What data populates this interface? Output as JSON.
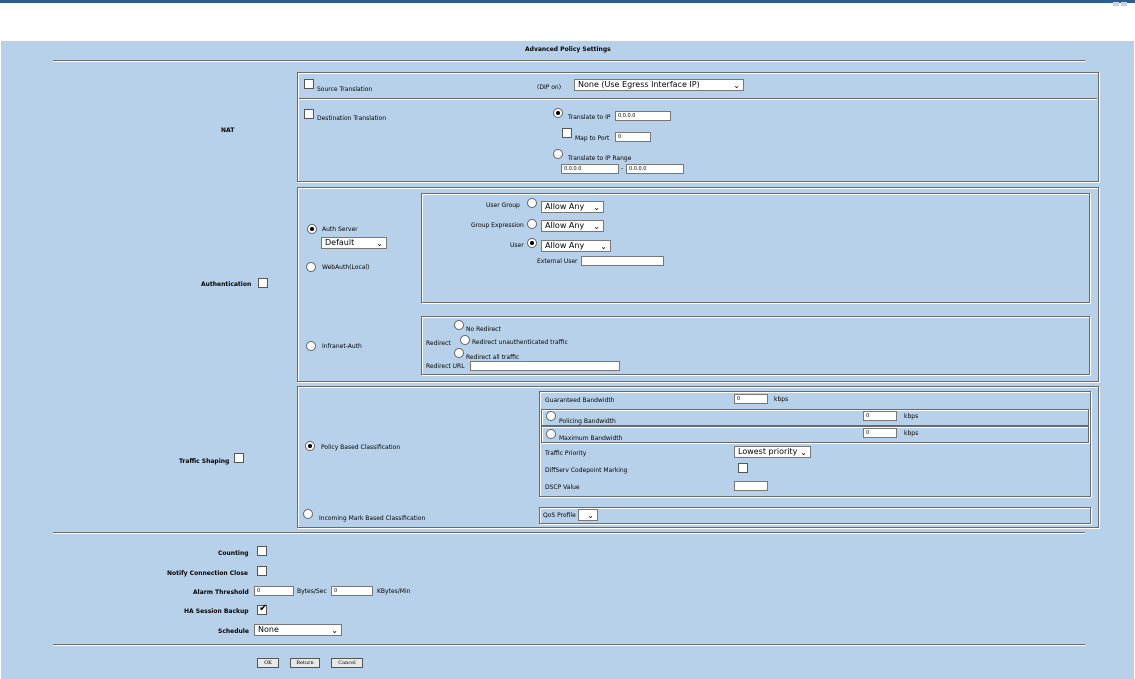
{
  "title": "Advanced Policy Settings",
  "nat": {
    "label": "NAT",
    "source_translation": "Source Translation",
    "dip_label": "(DIP on)",
    "dip_value": "None (Use Egress Interface IP)",
    "destination_translation": "Destination Translation",
    "translate_to_ip": "Translate to IP",
    "translate_ip_value": "0.0.0.0",
    "map_to_port": "Map to Port",
    "map_port_value": "0",
    "translate_to_range": "Translate to IP Range",
    "range_start": "0.0.0.0",
    "range_sep": "-",
    "range_end": "0.0.0.0"
  },
  "authentication": {
    "label": "Authentication",
    "auth_server": "Auth Server",
    "auth_server_value": "Default",
    "webauth": "WebAuth(Local)",
    "user_group": "User Group",
    "user_group_value": "Allow Any",
    "group_expression": "Group Expression",
    "group_expression_value": "Allow Any",
    "user": "User",
    "user_value": "Allow Any",
    "external_user": "External User",
    "external_user_value": "",
    "infranet_auth": "Infranet-Auth",
    "redirect": "Redirect",
    "no_redirect": "No Redirect",
    "redirect_unauth": "Redirect unauthenticated traffic",
    "redirect_all": "Redirect all traffic",
    "redirect_url": "Redirect URL",
    "redirect_url_value": ""
  },
  "traffic_shaping": {
    "label": "Traffic Shaping",
    "policy_based": "Policy Based Classification",
    "incoming_mark": "Incoming Mark Based Classification",
    "guaranteed_bw": "Guaranteed Bandwidth",
    "guaranteed_bw_value": "0",
    "kbps": "kbps",
    "policing_bw": "Policing Bandwidth",
    "policing_bw_value": "0",
    "maximum_bw": "Maximum Bandwidth",
    "maximum_bw_value": "0",
    "traffic_priority": "Traffic Priority",
    "traffic_priority_value": "Lowest priority",
    "diffserv": "DiffServ Codepoint Marking",
    "dscp": "DSCP Value",
    "dscp_value": "",
    "qos_profile": "QoS Profile",
    "qos_profile_value": ""
  },
  "other": {
    "counting": "Counting",
    "notify_close": "Notify Connection Close",
    "alarm_threshold": "Alarm Threshold",
    "alarm_bytes_value": "0",
    "bytes_per_sec": "Bytes/Sec",
    "alarm_kbytes_value": "0",
    "kbytes_per_min": "KBytes/Min",
    "ha_backup": "HA Session Backup",
    "schedule": "Schedule",
    "schedule_value": "None"
  },
  "buttons": {
    "ok": "OK",
    "return": "Return",
    "cancel": "Cancel"
  },
  "colors": {
    "panel_background": "#b8d1ea",
    "title_bar": "#2d5d8f"
  }
}
